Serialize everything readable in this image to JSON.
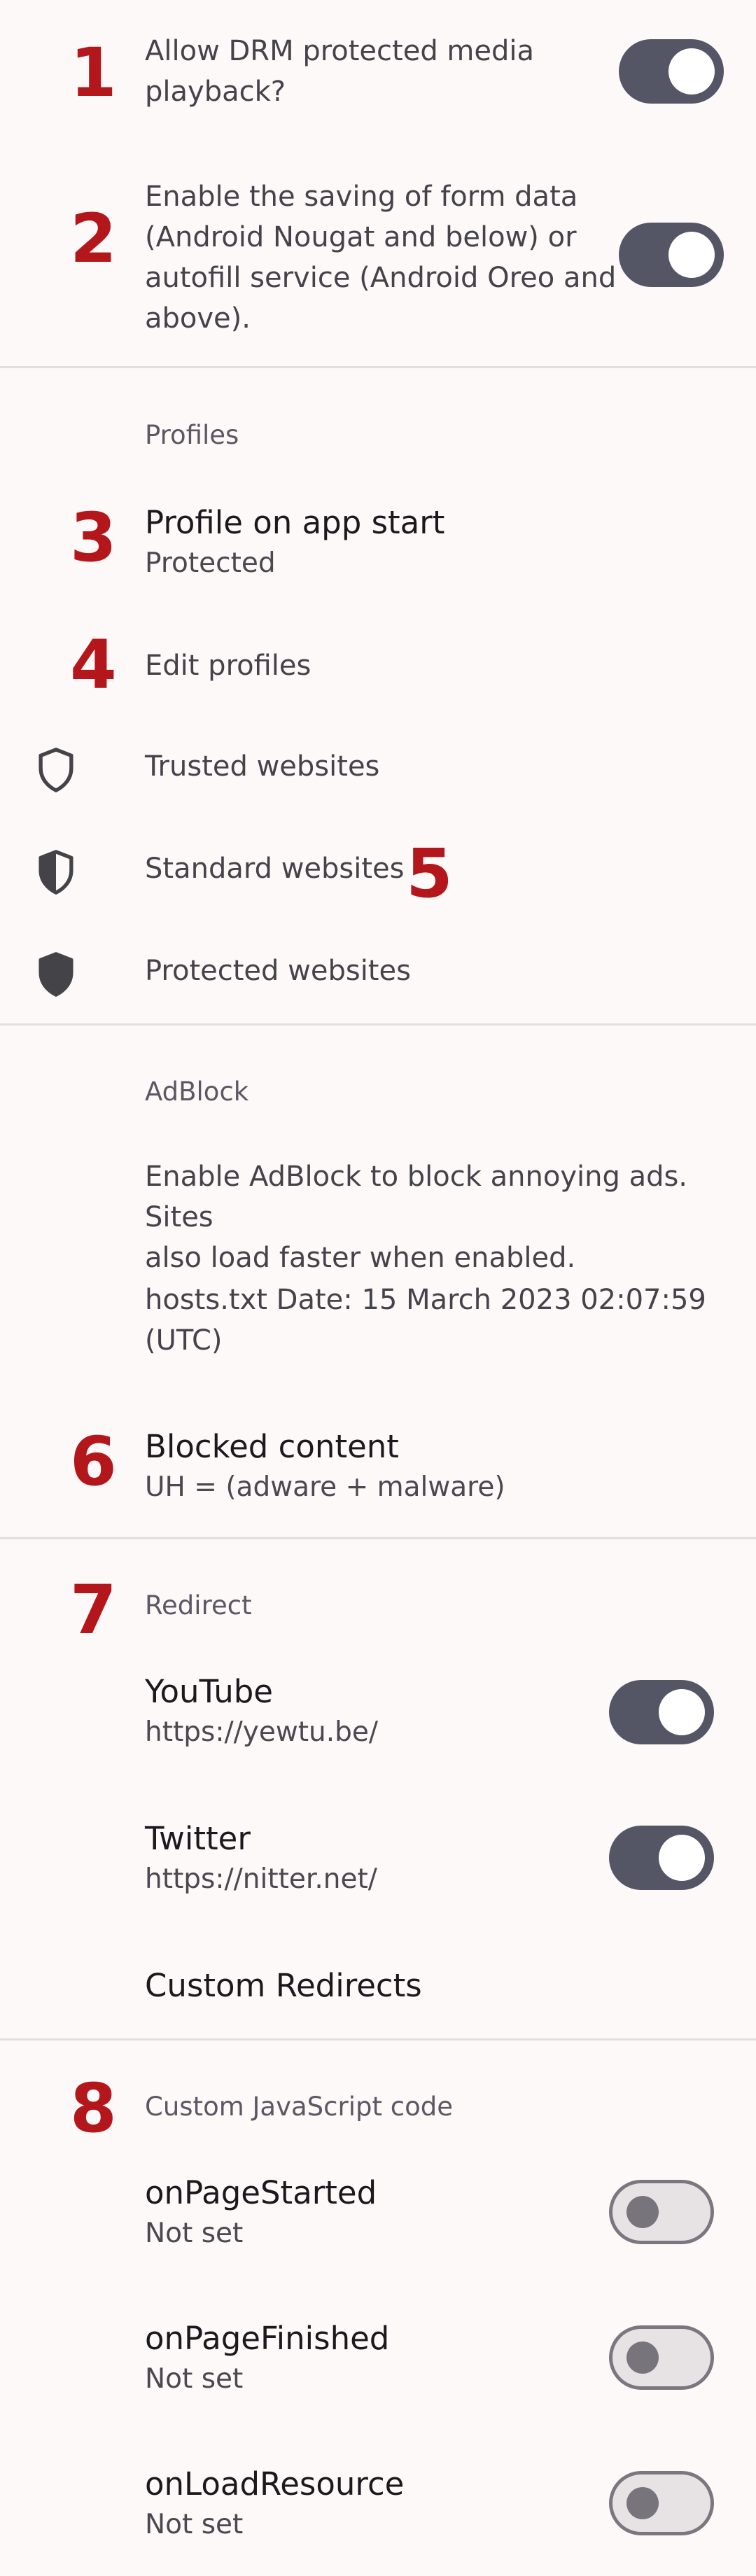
{
  "annotations": [
    "1",
    "2",
    "3",
    "4",
    "5",
    "6",
    "7",
    "8"
  ],
  "settings_top": {
    "drm": {
      "label_line1": "Allow DRM protected media",
      "label_line2": "playback?",
      "enabled": true
    },
    "form": {
      "line1": "Enable the saving of form data",
      "line2": "(Android Nougat and below) or",
      "line3": "autofill service (Android Oreo and",
      "line4": "above).",
      "enabled": true
    }
  },
  "profiles": {
    "header": "Profiles",
    "profile_on_start": {
      "title": "Profile on app start",
      "value": "Protected"
    },
    "edit_profiles": "Edit profiles",
    "trusted": "Trusted websites",
    "standard": "Standard websites",
    "protected": "Protected websites"
  },
  "adblock": {
    "header": "AdBlock",
    "desc_line1": "Enable AdBlock to block annoying ads. Sites",
    "desc_line2": "also load faster when enabled.",
    "hosts_line1": "hosts.txt Date: 15 March 2023 02:07:59",
    "hosts_line2": "(UTC)",
    "blocked": {
      "title": "Blocked content",
      "value": "UH = (adware + malware)"
    }
  },
  "redirect": {
    "header": "Redirect",
    "youtube": {
      "title": "YouTube",
      "url": "https://yewtu.be/",
      "enabled": true
    },
    "twitter": {
      "title": "Twitter",
      "url": "https://nitter.net/",
      "enabled": true
    },
    "custom": "Custom Redirects"
  },
  "javascript": {
    "header": "Custom JavaScript code",
    "items": [
      {
        "title": "onPageStarted",
        "value": "Not set",
        "enabled": false
      },
      {
        "title": "onPageFinished",
        "value": "Not set",
        "enabled": false
      },
      {
        "title": "onLoadResource",
        "value": "Not set",
        "enabled": false
      }
    ]
  },
  "colors": {
    "background": "#fdf9f9",
    "annotation": "#b3171c",
    "toggle_on": "#545666",
    "toggle_off": "#e7e2e4"
  }
}
